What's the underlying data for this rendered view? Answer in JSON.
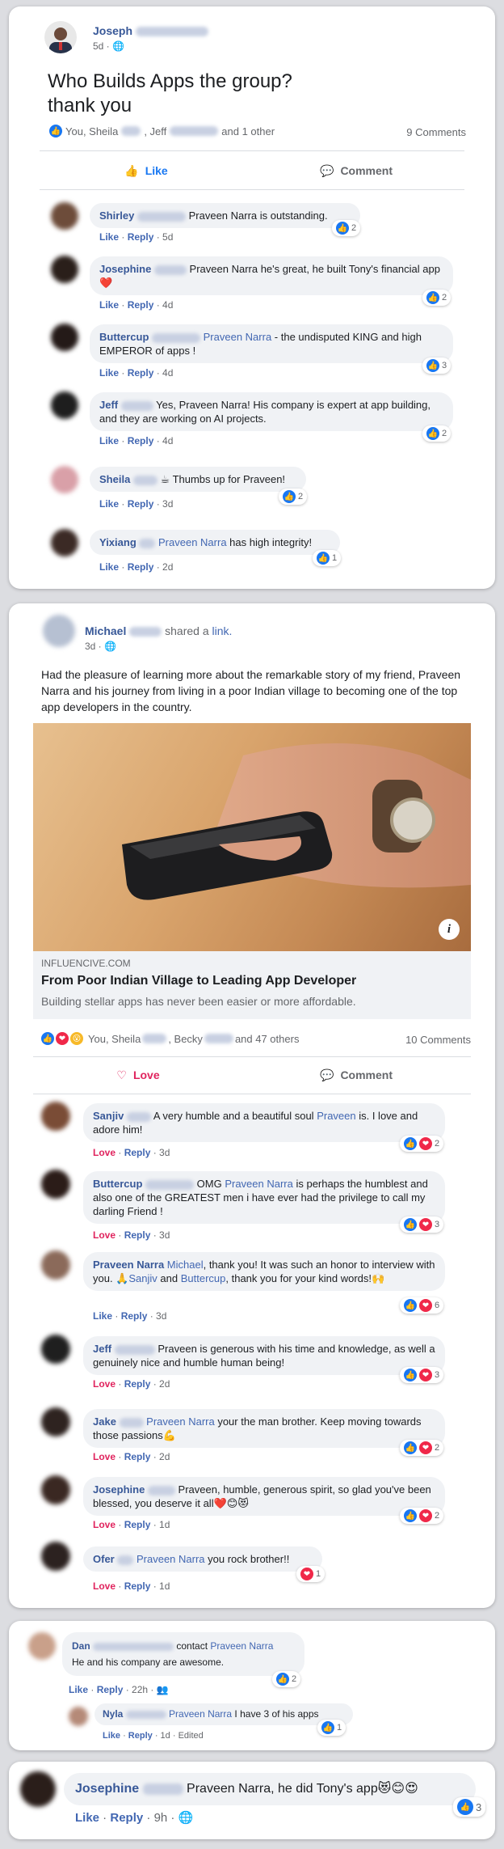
{
  "post1": {
    "author": "Joseph",
    "meta": "5d ·",
    "text": "Who Builds Apps the group?\nthank you",
    "reactions_text": "You, Sheila",
    "reactions_text2": ", Jeff",
    "reactions_text3": "and 1 other",
    "comments_count": "9 Comments",
    "like_label": "Like",
    "comment_label": "Comment",
    "comments": [
      {
        "name": "Shirley",
        "text": "Praveen Narra is outstanding.",
        "like": "Like",
        "reply": "Reply",
        "time": "5d",
        "count": "2"
      },
      {
        "name": "Josephine",
        "text": "Praveen Narra he's great, he built Tony's financial app❤️",
        "like": "Like",
        "reply": "Reply",
        "time": "4d",
        "count": "2"
      },
      {
        "name": "Buttercup",
        "mention": "Praveen Narra",
        "text": " - the undisputed KING and high EMPEROR of apps !",
        "like": "Like",
        "reply": "Reply",
        "time": "4d",
        "count": "3"
      },
      {
        "name": "Jeff",
        "text": "Yes, Praveen Narra! His company is expert at app building, and they are working on AI projects.",
        "like": "Like",
        "reply": "Reply",
        "time": "4d",
        "count": "2"
      },
      {
        "name": "Sheila",
        "text": "☕ Thumbs up for Praveen!",
        "like": "Like",
        "reply": "Reply",
        "time": "3d",
        "count": "2"
      },
      {
        "name": "Yixiang",
        "mention": "Praveen Narra",
        "text": " has high integrity!",
        "like": "Like",
        "reply": "Reply",
        "time": "2d",
        "count": "1"
      }
    ]
  },
  "post2": {
    "author": "Michael",
    "shared_text": "shared a",
    "link_word": "link.",
    "meta": "3d ·",
    "body": "Had the pleasure of learning more about the remarkable story of my friend, Praveen Narra and his journey from living in a poor Indian village to becoming one of the top app developers in the country.",
    "link_domain": "INFLUENCIVE.COM",
    "link_title": "From Poor Indian Village to Leading App Developer",
    "link_desc": "Building stellar apps has never been easier or more affordable.",
    "reactions_a": "You, Sheila",
    "reactions_b": ", Becky",
    "reactions_c": "and 47 others",
    "comments_count": "10 Comments",
    "love_label": "Love",
    "comment_label": "Comment",
    "comments": [
      {
        "name": "Sanjiv",
        "text1": "A very humble and a beautiful soul ",
        "mention": "Praveen",
        "text2": " is. I love and adore him!",
        "act": "Love",
        "reply": "Reply",
        "time": "3d",
        "count": "2"
      },
      {
        "name": "Buttercup",
        "text1": "OMG ",
        "mention": "Praveen Narra",
        "text2": " is perhaps the humblest and also one of the GREATEST men i have ever had the privilege to call my darling Friend !",
        "act": "Love",
        "reply": "Reply",
        "time": "3d",
        "count": "3"
      },
      {
        "name": "Praveen Narra",
        "mention": "Michael",
        "text1": ", thank you! It was such an honor to interview with you. 🙏",
        "mention2": "Sanjiv",
        "text2": " and ",
        "mention3": "Buttercup",
        "text3": ", thank you for your kind words!🙌",
        "act": "Like",
        "reply": "Reply",
        "time": "3d",
        "count": "6"
      },
      {
        "name": "Jeff",
        "text1": "Praveen is generous with his time and knowledge, as well a genuinely nice and humble human being!",
        "act": "Love",
        "reply": "Reply",
        "time": "2d",
        "count": "3"
      },
      {
        "name": "Jake",
        "mention": "Praveen Narra",
        "text1": " your the man brother. Keep moving towards those passions💪",
        "act": "Love",
        "reply": "Reply",
        "time": "2d",
        "count": "2"
      },
      {
        "name": "Josephine",
        "text1": "Praveen, humble, generous spirit, so glad you've been blessed, you deserve it all❤️😊😻",
        "act": "Love",
        "reply": "Reply",
        "time": "1d",
        "count": "2"
      },
      {
        "name": "Ofer",
        "mention": "Praveen Narra",
        "text1": " you rock brother!!",
        "act": "Love",
        "reply": "Reply",
        "time": "1d",
        "count": "1"
      }
    ]
  },
  "post3": {
    "c1": {
      "name": "Dan",
      "text1": " contact ",
      "mention": "Praveen Narra",
      "line2": "He and his company are awesome.",
      "like": "Like",
      "reply": "Reply",
      "time": "22h ·",
      "count": "2"
    },
    "c2": {
      "name": "Nyla",
      "mention": "Praveen Narra",
      "text": " I have 3 of his apps",
      "like": "Like",
      "reply": "Reply",
      "time": "1d",
      "edited": "· Edited",
      "count": "1"
    }
  },
  "post4": {
    "name": "Josephine",
    "text": " Praveen Narra, he did Tony's app😻😊😍",
    "like": "Like",
    "reply": "Reply",
    "time": "9h ·",
    "count": "3"
  }
}
